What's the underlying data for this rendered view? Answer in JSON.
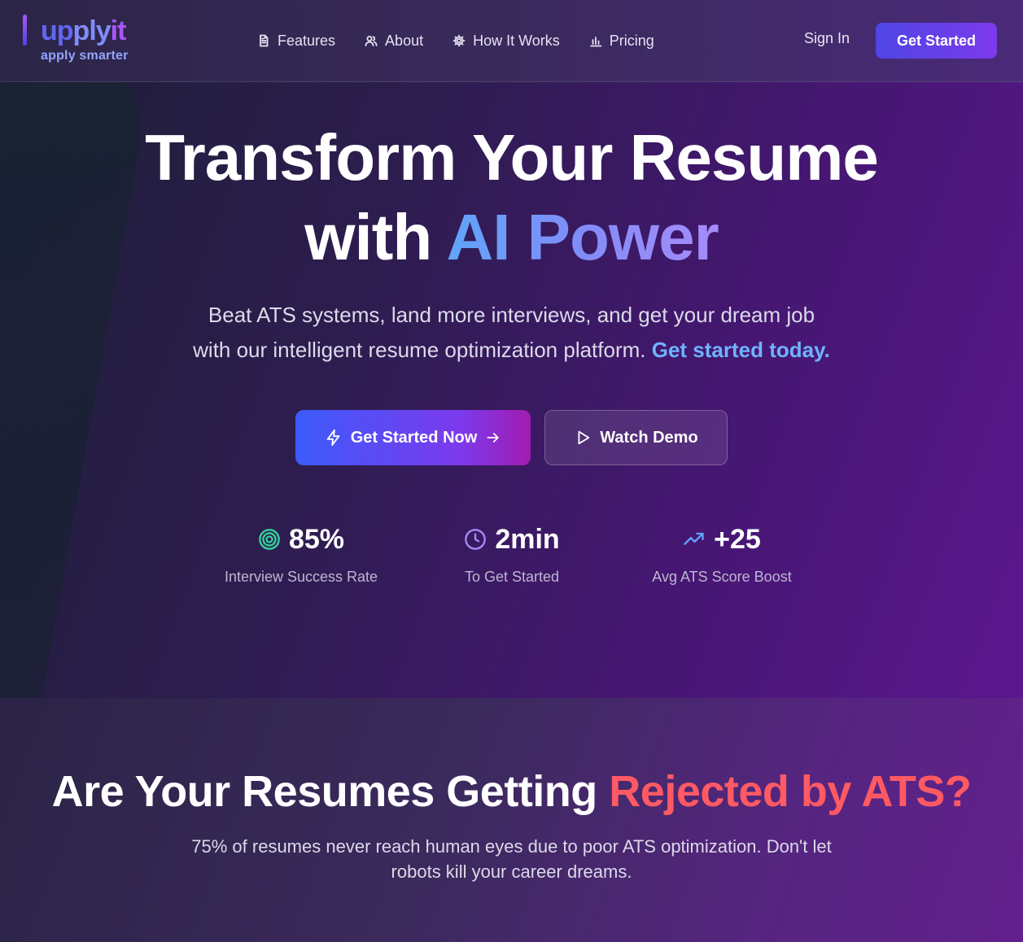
{
  "logo": {
    "part1": "up",
    "part2": "ply",
    "part3": "it",
    "tagline": "apply smarter"
  },
  "nav": {
    "items": [
      {
        "label": "Features",
        "icon": "document-icon"
      },
      {
        "label": "About",
        "icon": "users-icon"
      },
      {
        "label": "How It Works",
        "icon": "gear-icon"
      },
      {
        "label": "Pricing",
        "icon": "bar-chart-icon"
      }
    ],
    "signin": "Sign In",
    "cta": "Get Started"
  },
  "hero": {
    "title_line1": "Transform Your Resume",
    "title_line2_prefix": "with ",
    "title_line2_highlight": "AI Power",
    "subtitle_line1": "Beat ATS systems, land more interviews, and get your dream job",
    "subtitle_line2": "with our intelligent resume optimization platform. ",
    "subtitle_link": "Get started today.",
    "primary_button": "Get Started Now",
    "secondary_button": "Watch Demo"
  },
  "stats": [
    {
      "value": "85%",
      "label": "Interview Success Rate",
      "icon": "target-icon",
      "color": "#34d399"
    },
    {
      "value": "2min",
      "label": "To Get Started",
      "icon": "clock-icon",
      "color": "#a78bfa"
    },
    {
      "value": "+25",
      "label": "Avg ATS Score Boost",
      "icon": "trending-up-icon",
      "color": "#60a5fa"
    }
  ],
  "section2": {
    "title_prefix": "Are Your Resumes Getting ",
    "title_highlight": "Rejected by ATS?",
    "subtitle_line1": "75% of resumes never reach human eyes due to poor ATS optimization. Don't let",
    "subtitle_line2": "robots kill your career dreams."
  },
  "colors": {
    "accent": "#4f46e5",
    "accent2": "#7c3aed",
    "danger": "#ff5a64",
    "link": "#6fb3ff"
  }
}
